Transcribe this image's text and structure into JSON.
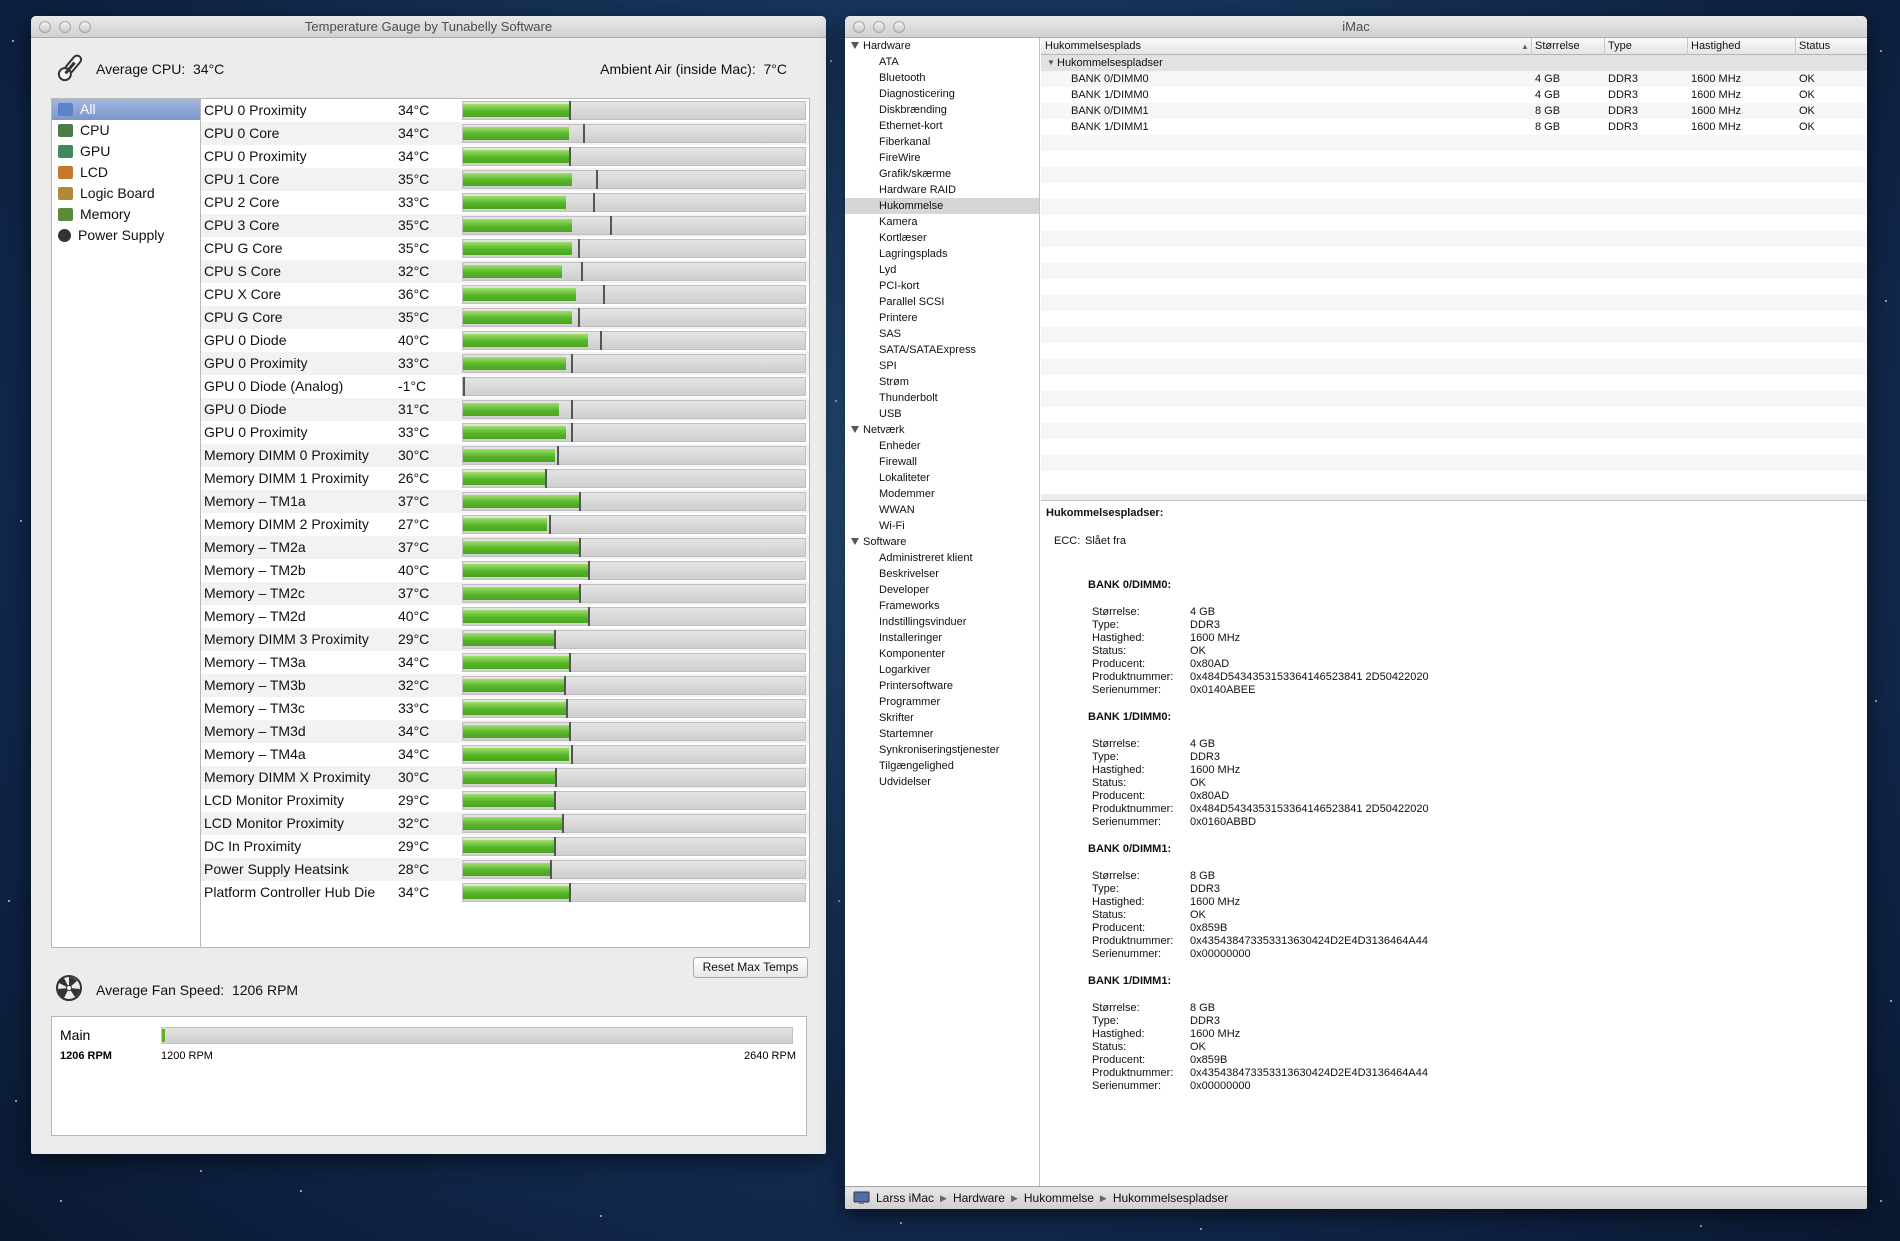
{
  "gauge": {
    "title": "Temperature Gauge by Tunabelly Software",
    "avg_cpu_label": "Average CPU:",
    "avg_cpu_value": "34°C",
    "ambient_label": "Ambient Air (inside Mac):",
    "ambient_value": "7°C",
    "sidebar": [
      {
        "label": "All",
        "icon": "display-icon"
      },
      {
        "label": "CPU",
        "icon": "cpu-icon"
      },
      {
        "label": "GPU",
        "icon": "gpu-icon"
      },
      {
        "label": "LCD",
        "icon": "lcd-icon"
      },
      {
        "label": "Logic Board",
        "icon": "logic-board-icon"
      },
      {
        "label": "Memory",
        "icon": "memory-icon"
      },
      {
        "label": "Power Supply",
        "icon": "power-supply-icon"
      }
    ],
    "sensors": [
      {
        "name": "CPU 0 Proximity",
        "temp": "34°C",
        "level": 0.31,
        "max": 0.31
      },
      {
        "name": "CPU 0 Core",
        "temp": "34°C",
        "level": 0.31,
        "max": 0.35
      },
      {
        "name": "CPU 0 Proximity",
        "temp": "34°C",
        "level": 0.31,
        "max": 0.31
      },
      {
        "name": "CPU 1 Core",
        "temp": "35°C",
        "level": 0.32,
        "max": 0.39
      },
      {
        "name": "CPU 2 Core",
        "temp": "33°C",
        "level": 0.3,
        "max": 0.38
      },
      {
        "name": "CPU 3 Core",
        "temp": "35°C",
        "level": 0.32,
        "max": 0.43
      },
      {
        "name": "CPU G Core",
        "temp": "35°C",
        "level": 0.32,
        "max": 0.335
      },
      {
        "name": "CPU S Core",
        "temp": "32°C",
        "level": 0.29,
        "max": 0.345
      },
      {
        "name": "CPU X Core",
        "temp": "36°C",
        "level": 0.33,
        "max": 0.41
      },
      {
        "name": "CPU G Core",
        "temp": "35°C",
        "level": 0.32,
        "max": 0.335
      },
      {
        "name": "GPU 0 Diode",
        "temp": "40°C",
        "level": 0.365,
        "max": 0.4
      },
      {
        "name": "GPU 0 Proximity",
        "temp": "33°C",
        "level": 0.3,
        "max": 0.315
      },
      {
        "name": "GPU 0 Diode (Analog)",
        "temp": "-1°C",
        "level": 0.0,
        "max": 0.0
      },
      {
        "name": "GPU 0 Diode",
        "temp": "31°C",
        "level": 0.28,
        "max": 0.315
      },
      {
        "name": "GPU 0 Proximity",
        "temp": "33°C",
        "level": 0.3,
        "max": 0.315
      },
      {
        "name": "Memory DIMM 0 Proximity",
        "temp": "30°C",
        "level": 0.27,
        "max": 0.275
      },
      {
        "name": "Memory DIMM 1 Proximity",
        "temp": "26°C",
        "level": 0.24,
        "max": 0.24
      },
      {
        "name": "Memory – TM1a",
        "temp": "37°C",
        "level": 0.34,
        "max": 0.34
      },
      {
        "name": "Memory DIMM 2 Proximity",
        "temp": "27°C",
        "level": 0.245,
        "max": 0.25
      },
      {
        "name": "Memory – TM2a",
        "temp": "37°C",
        "level": 0.34,
        "max": 0.34
      },
      {
        "name": "Memory – TM2b",
        "temp": "40°C",
        "level": 0.365,
        "max": 0.365
      },
      {
        "name": "Memory – TM2c",
        "temp": "37°C",
        "level": 0.34,
        "max": 0.34
      },
      {
        "name": "Memory – TM2d",
        "temp": "40°C",
        "level": 0.365,
        "max": 0.365
      },
      {
        "name": "Memory DIMM 3 Proximity",
        "temp": "29°C",
        "level": 0.265,
        "max": 0.265
      },
      {
        "name": "Memory – TM3a",
        "temp": "34°C",
        "level": 0.31,
        "max": 0.31
      },
      {
        "name": "Memory – TM3b",
        "temp": "32°C",
        "level": 0.295,
        "max": 0.295
      },
      {
        "name": "Memory – TM3c",
        "temp": "33°C",
        "level": 0.3,
        "max": 0.3
      },
      {
        "name": "Memory – TM3d",
        "temp": "34°C",
        "level": 0.31,
        "max": 0.31
      },
      {
        "name": "Memory – TM4a",
        "temp": "34°C",
        "level": 0.31,
        "max": 0.315
      },
      {
        "name": "Memory DIMM X Proximity",
        "temp": "30°C",
        "level": 0.27,
        "max": 0.27
      },
      {
        "name": "LCD Monitor Proximity",
        "temp": "29°C",
        "level": 0.265,
        "max": 0.265
      },
      {
        "name": "LCD Monitor Proximity",
        "temp": "32°C",
        "level": 0.29,
        "max": 0.29
      },
      {
        "name": "DC In Proximity",
        "temp": "29°C",
        "level": 0.265,
        "max": 0.265
      },
      {
        "name": "Power Supply Heatsink",
        "temp": "28°C",
        "level": 0.255,
        "max": 0.255
      },
      {
        "name": "Platform Controller Hub Die",
        "temp": "34°C",
        "level": 0.31,
        "max": 0.31
      }
    ],
    "reset_label": "Reset Max Temps",
    "fan_avg_label": "Average Fan Speed:",
    "fan_avg_value": "1206 RPM",
    "fan": {
      "name": "Main",
      "rpm": "1206 RPM",
      "min": "1200 RPM",
      "max": "2640 RPM",
      "level": 0.004
    }
  },
  "sysinfo": {
    "title": "iMac",
    "nav": [
      {
        "label": "Hardware",
        "cat": true
      },
      {
        "label": "ATA"
      },
      {
        "label": "Bluetooth"
      },
      {
        "label": "Diagnosticering"
      },
      {
        "label": "Diskbrænding"
      },
      {
        "label": "Ethernet-kort"
      },
      {
        "label": "Fiberkanal"
      },
      {
        "label": "FireWire"
      },
      {
        "label": "Grafik/skærme"
      },
      {
        "label": "Hardware RAID"
      },
      {
        "label": "Hukommelse",
        "sel": true
      },
      {
        "label": "Kamera"
      },
      {
        "label": "Kortlæser"
      },
      {
        "label": "Lagringsplads"
      },
      {
        "label": "Lyd"
      },
      {
        "label": "PCI-kort"
      },
      {
        "label": "Parallel SCSI"
      },
      {
        "label": "Printere"
      },
      {
        "label": "SAS"
      },
      {
        "label": "SATA/SATAExpress"
      },
      {
        "label": "SPI"
      },
      {
        "label": "Strøm"
      },
      {
        "label": "Thunderbolt"
      },
      {
        "label": "USB"
      },
      {
        "label": "Netværk",
        "cat": true
      },
      {
        "label": "Enheder"
      },
      {
        "label": "Firewall"
      },
      {
        "label": "Lokaliteter"
      },
      {
        "label": "Modemmer"
      },
      {
        "label": "WWAN"
      },
      {
        "label": "Wi-Fi"
      },
      {
        "label": "Software",
        "cat": true
      },
      {
        "label": "Administreret klient"
      },
      {
        "label": "Beskrivelser"
      },
      {
        "label": "Developer"
      },
      {
        "label": "Frameworks"
      },
      {
        "label": "Indstillingsvinduer"
      },
      {
        "label": "Installeringer"
      },
      {
        "label": "Komponenter"
      },
      {
        "label": "Logarkiver"
      },
      {
        "label": "Printersoftware"
      },
      {
        "label": "Programmer"
      },
      {
        "label": "Skrifter"
      },
      {
        "label": "Startemner"
      },
      {
        "label": "Synkroniseringstjenester"
      },
      {
        "label": "Tilgængelighed"
      },
      {
        "label": "Udvidelser"
      }
    ],
    "columns": [
      "Hukommelsesplads",
      "Størrelse",
      "Type",
      "Hastighed",
      "Status"
    ],
    "group": "Hukommelsespladser",
    "rows": [
      [
        "BANK 0/DIMM0",
        "4 GB",
        "DDR3",
        "1600 MHz",
        "OK"
      ],
      [
        "BANK 1/DIMM0",
        "4 GB",
        "DDR3",
        "1600 MHz",
        "OK"
      ],
      [
        "BANK 0/DIMM1",
        "8 GB",
        "DDR3",
        "1600 MHz",
        "OK"
      ],
      [
        "BANK 1/DIMM1",
        "8 GB",
        "DDR3",
        "1600 MHz",
        "OK"
      ]
    ],
    "detail_title": "Hukommelsespladser:",
    "ecc_label": "ECC:",
    "ecc_value": "Slået fra",
    "field_labels": [
      "Størrelse:",
      "Type:",
      "Hastighed:",
      "Status:",
      "Producent:",
      "Produktnummer:",
      "Serienummer:"
    ],
    "banks": [
      {
        "name": "BANK 0/DIMM0:",
        "values": [
          "4 GB",
          "DDR3",
          "1600 MHz",
          "OK",
          "0x80AD",
          "0x484D5434353153364146523841 2D50422020",
          "0x0140ABEE"
        ]
      },
      {
        "name": "BANK 1/DIMM0:",
        "values": [
          "4 GB",
          "DDR3",
          "1600 MHz",
          "OK",
          "0x80AD",
          "0x484D5434353153364146523841 2D50422020",
          "0x0160ABBD"
        ]
      },
      {
        "name": "BANK 0/DIMM1:",
        "values": [
          "8 GB",
          "DDR3",
          "1600 MHz",
          "OK",
          "0x859B",
          "0x435438473353313630424D2E4D3136464A44",
          "0x00000000"
        ]
      },
      {
        "name": "BANK 1/DIMM1:",
        "values": [
          "8 GB",
          "DDR3",
          "1600 MHz",
          "OK",
          "0x859B",
          "0x435438473353313630424D2E4D3136464A44",
          "0x00000000"
        ]
      }
    ],
    "breadcrumb": [
      "Larss iMac",
      "Hardware",
      "Hukommelse",
      "Hukommelsespladser"
    ]
  }
}
